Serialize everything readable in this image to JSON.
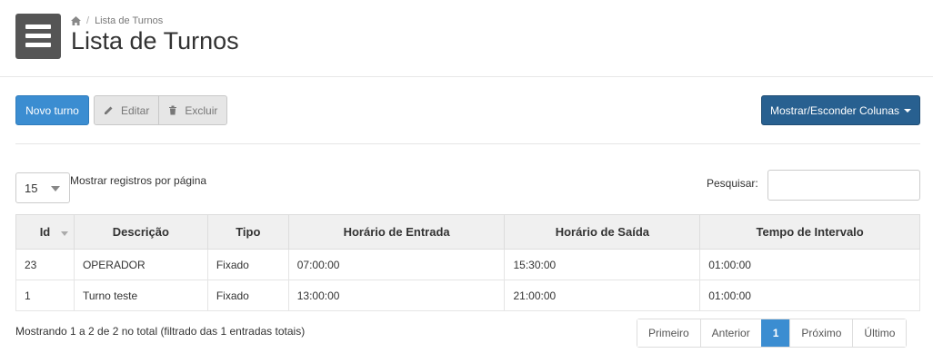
{
  "breadcrumb": {
    "current": "Lista de Turnos"
  },
  "page": {
    "title": "Lista de Turnos"
  },
  "toolbar": {
    "new_label": "Novo turno",
    "edit_label": "Editar",
    "delete_label": "Excluir",
    "columns_label": "Mostrar/Esconder Colunas"
  },
  "length": {
    "value": "15",
    "label": "Mostrar registros por página"
  },
  "search": {
    "label": "Pesquisar:",
    "value": ""
  },
  "table": {
    "headers": [
      "Id",
      "Descrição",
      "Tipo",
      "Horário de Entrada",
      "Horário de Saída",
      "Tempo de Intervalo"
    ],
    "rows": [
      [
        "23",
        "OPERADOR",
        "Fixado",
        "07:00:00",
        "15:30:00",
        "01:00:00"
      ],
      [
        "1",
        "Turno teste",
        "Fixado",
        "13:00:00",
        "21:00:00",
        "01:00:00"
      ]
    ]
  },
  "info": "Mostrando 1 a 2 de 2 no total (filtrado das 1 entradas totais)",
  "pagination": {
    "first": "Primeiro",
    "prev": "Anterior",
    "current": "1",
    "next": "Próximo",
    "last": "Último"
  },
  "colors": {
    "primary": "#3b8dd1",
    "dark_primary": "#286090"
  }
}
